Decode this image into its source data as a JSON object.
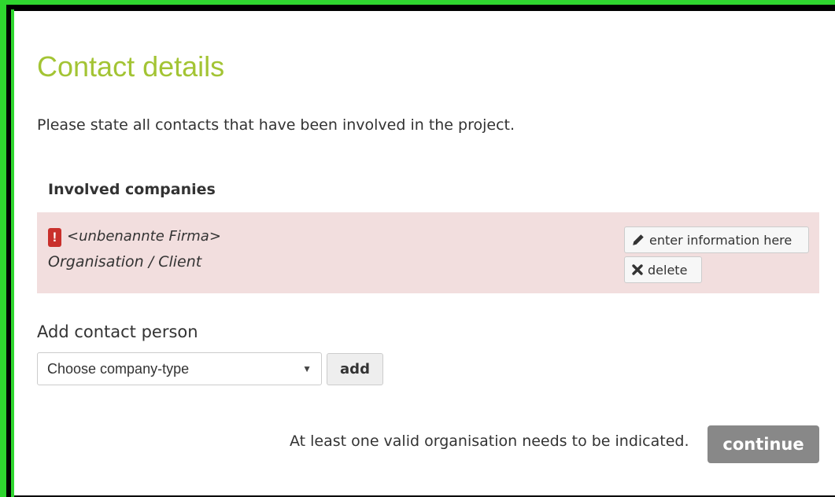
{
  "page": {
    "title": "Contact details",
    "intro": "Please state all contacts that have been involved in the project."
  },
  "companies": {
    "heading": "Involved companies",
    "items": [
      {
        "name": "<unbenannte Firma>",
        "type": "Organisation / Client",
        "status": "error",
        "error_symbol": "!",
        "edit_label": "enter information here",
        "delete_label": "delete"
      }
    ]
  },
  "add_contact": {
    "heading": "Add contact person",
    "select_value": "Choose company-type",
    "add_label": "add"
  },
  "footer": {
    "note": "At least one valid organisation needs to be indicated.",
    "continue_label": "continue"
  },
  "colors": {
    "title": "#a3c434",
    "error_row_bg": "#f2dede",
    "error_icon": "#c9302c",
    "continue_bg": "#888888",
    "frame_green": "#2fd62f"
  },
  "icons": {
    "edit": "pencil-icon",
    "delete": "x-icon",
    "error": "exclamation-icon",
    "select": "caret-down-icon"
  }
}
